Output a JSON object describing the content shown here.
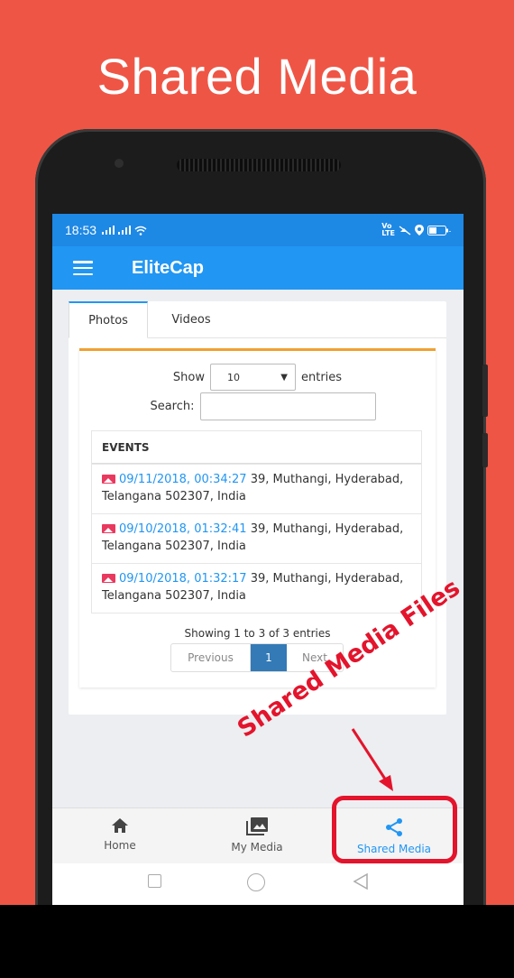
{
  "banner": {
    "title": "Shared Media"
  },
  "status_bar": {
    "time": "18:53",
    "left_icons": [
      "signal-icon",
      "signal-icon",
      "wifi-icon"
    ],
    "right_icons": [
      "volte-icon",
      "mute-icon",
      "location-icon",
      "battery-icon"
    ]
  },
  "app_bar": {
    "title": "EliteCap",
    "menu_icon": "hamburger-icon"
  },
  "tabs": [
    {
      "label": "Photos",
      "active": true
    },
    {
      "label": "Videos",
      "active": false
    }
  ],
  "table_controls": {
    "show_label": "Show",
    "page_size": "10",
    "entries_label": "entries",
    "search_label": "Search:",
    "search_value": ""
  },
  "table": {
    "header": "EVENTS",
    "rows": [
      {
        "timestamp": "09/11/2018, 00:34:27",
        "address_line1": " 39, Muthangi, Hyderabad,",
        "address_line2": "Telangana 502307, India"
      },
      {
        "timestamp": "09/10/2018, 01:32:41",
        "address_line1": " 39, Muthangi, Hyderabad,",
        "address_line2": "Telangana 502307, India"
      },
      {
        "timestamp": "09/10/2018, 01:32:17",
        "address_line1": " 39, Muthangi, Hyderabad,",
        "address_line2": "Telangana 502307, India"
      }
    ]
  },
  "pagination": {
    "summary": "Showing 1 to 3 of 3 entries",
    "previous": "Previous",
    "current": "1",
    "next": "Next"
  },
  "bottom_nav": [
    {
      "label": "Home",
      "icon": "home-icon",
      "active": false
    },
    {
      "label": "My Media",
      "icon": "photo-library-icon",
      "active": false
    },
    {
      "label": "Shared Media",
      "icon": "share-icon",
      "active": true
    }
  ],
  "annotation": {
    "text": "Shared Media Files"
  },
  "colors": {
    "background": "#ef5545",
    "primary": "#2196f3",
    "accent_tab_line": "#f0a030",
    "annotation": "#e3142c",
    "pager_active": "#337ab7"
  }
}
